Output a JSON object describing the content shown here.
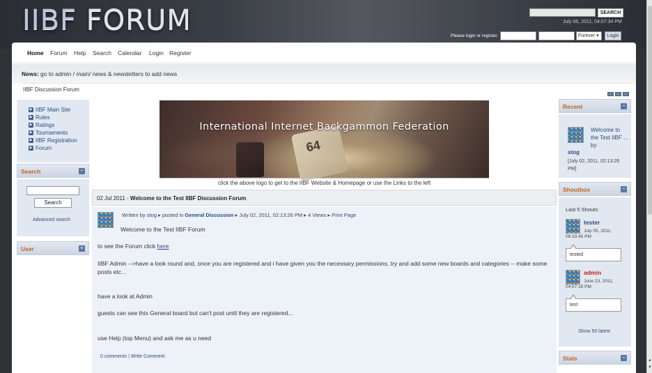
{
  "header": {
    "logo_main": "IIBF",
    "logo_second": "FORUM",
    "search_button": "SEARCH",
    "date": "July 06, 2011, 04:07:34 PM",
    "login_prompt": "Please login or register.",
    "login_duration": "Forever",
    "login_button": "Login"
  },
  "nav": {
    "items": [
      "Home",
      "Forum",
      "Help",
      "Search",
      "Calendar",
      "Login",
      "Register"
    ],
    "active": "Home"
  },
  "news": {
    "label": "News:",
    "text": "go to admin / main/ news & newsletters to add news"
  },
  "breadcrumb": "IIBF Discussion Forum",
  "left_sidebar": {
    "links": [
      "IIBF Main Site",
      "Rules",
      "Ratings",
      "Tournaments",
      "IIBF Registration",
      "Forum"
    ],
    "search_title": "Search",
    "search_button": "Search",
    "advanced_search": "Advanced search",
    "user_title": "User"
  },
  "banner": {
    "title": "International Internet Backgammon Federation",
    "die_text": "64",
    "caption": "click the above logo to get to the IIBF Website & Homepage or use the Links to the left"
  },
  "post": {
    "date": "02 Jul 2011",
    "dash": "-",
    "title": "Welcome to the Test IIBF Discussion Forum",
    "written_by": "Written by",
    "author": "stog",
    "posted_in": "posted in",
    "board": "General Discussion",
    "timestamp": "July 02, 2011, 02:13:26 PM",
    "views": "4 Views",
    "print": "Print Page",
    "lines": [
      "Welcome to the Test IIBF Forum",
      "to see the Forum click",
      "IIBF Admin -->have a look round and, once you are registered and i have given you the necessary permissions, try and add some new boards and categories -- make some posts etc...",
      "have a look at Admin",
      "guests can see this General board but can't post until they are registered...",
      "use Help (top Menu) and ask me as u need"
    ],
    "link_here": "here",
    "comments": "0 comments",
    "footer_sep": "|",
    "write_comment": "Write Comment"
  },
  "right_sidebar": {
    "recent_title": "Recent",
    "recent_item": "Welcome to the Test IIBF ... by",
    "recent_author": "stog",
    "recent_date": "[July 02, 2011, 02:13:26 PM]",
    "shoutbox_title": "Shoutbox",
    "shout_header": "Last 5 Shouts:",
    "shouts": [
      {
        "user": "tester",
        "date": "July 05, 2011, 06:33:45 PM",
        "text": "tested",
        "color": "#2b4a7e"
      },
      {
        "user": "admin",
        "date": "June 23, 2011, 04:57:18 PM",
        "text": "test",
        "color": "#c0201e"
      }
    ],
    "show_latest": "Show 50 latest",
    "stats_title": "Stats"
  }
}
